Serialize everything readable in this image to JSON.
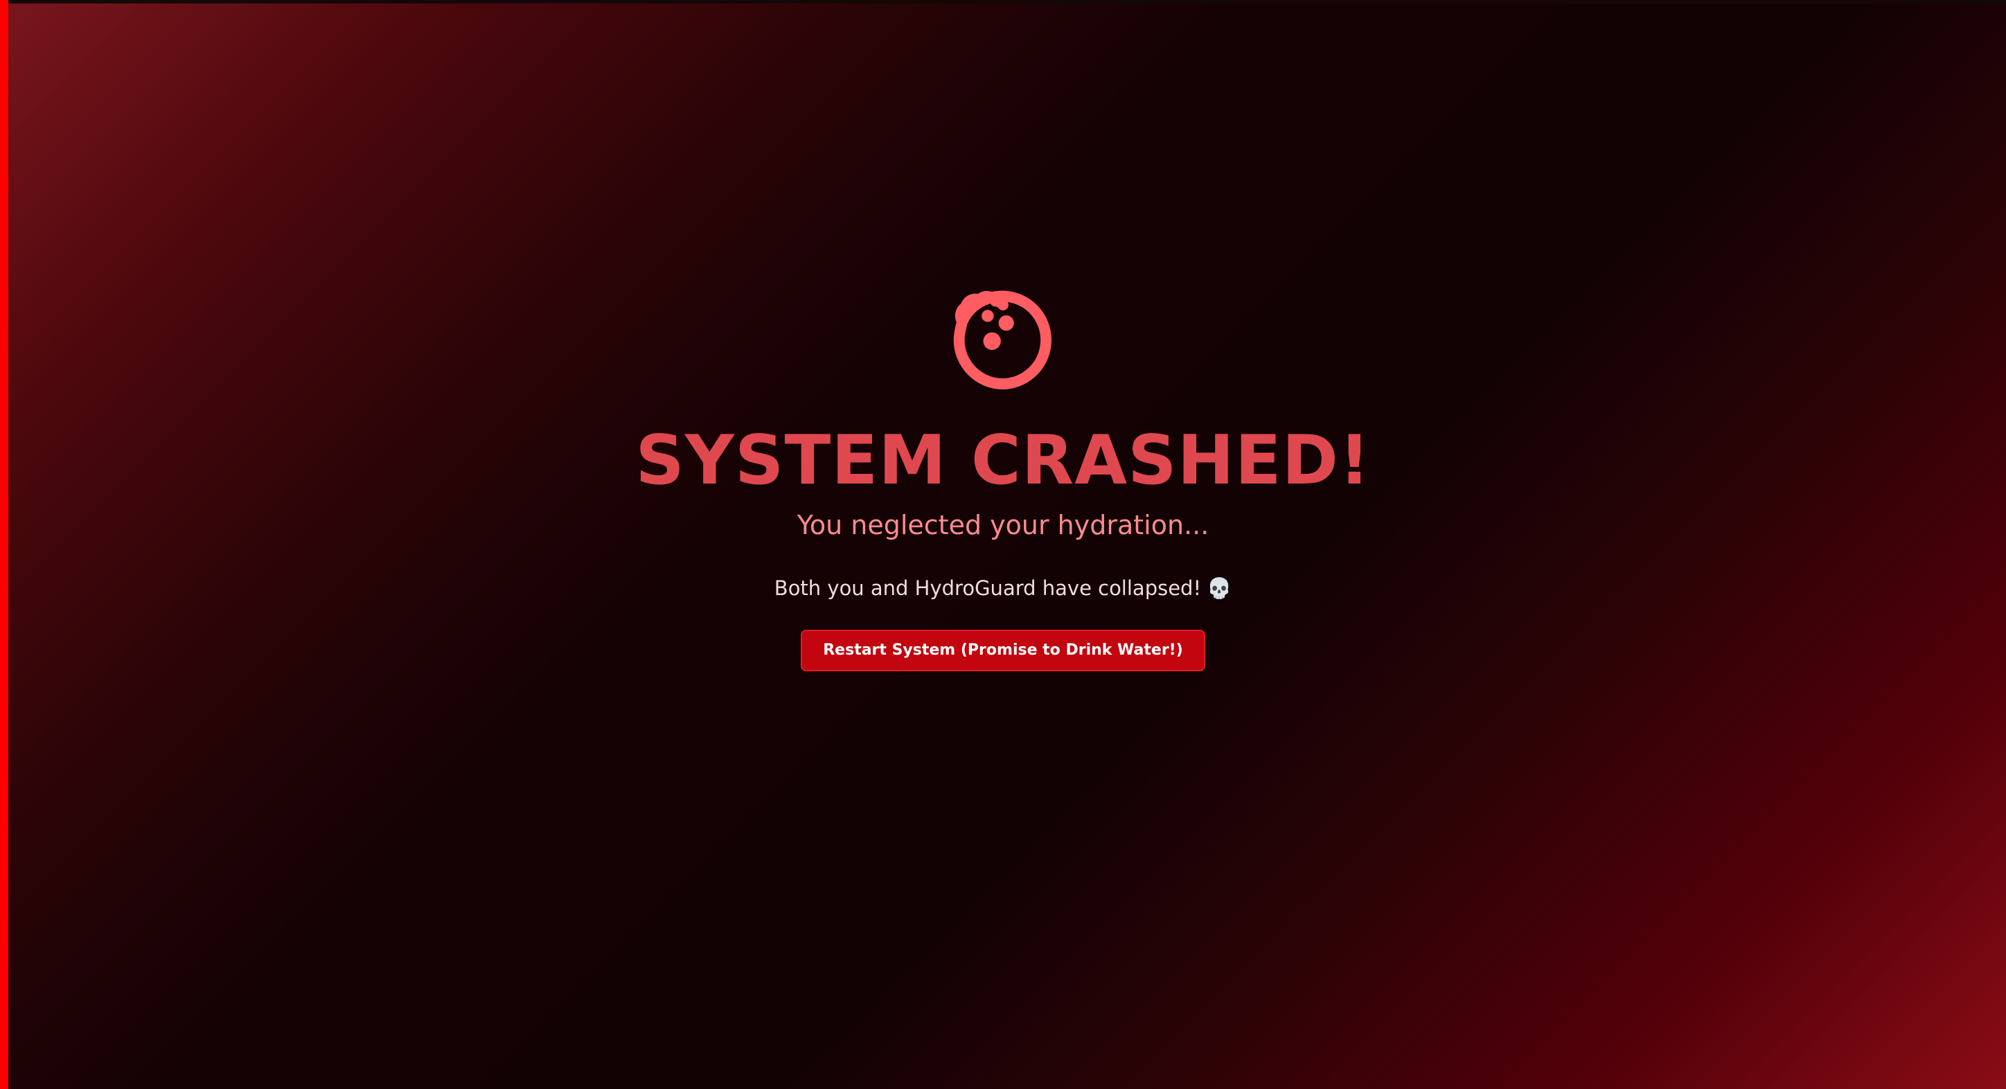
{
  "colors": {
    "accent_title": "#e0484f",
    "subtitle": "#ff8a8f",
    "button_bg": "#c2050f",
    "left_edge_bar": "#ff0000"
  },
  "crash": {
    "icon": "dizzy-face-icon",
    "title": "SYSTEM CRASHED!",
    "subtitle": "You neglected your hydration...",
    "message": "Both you and HydroGuard have collapsed!",
    "message_emoji": "💀",
    "button_label": "Restart System (Promise to Drink Water!)"
  }
}
